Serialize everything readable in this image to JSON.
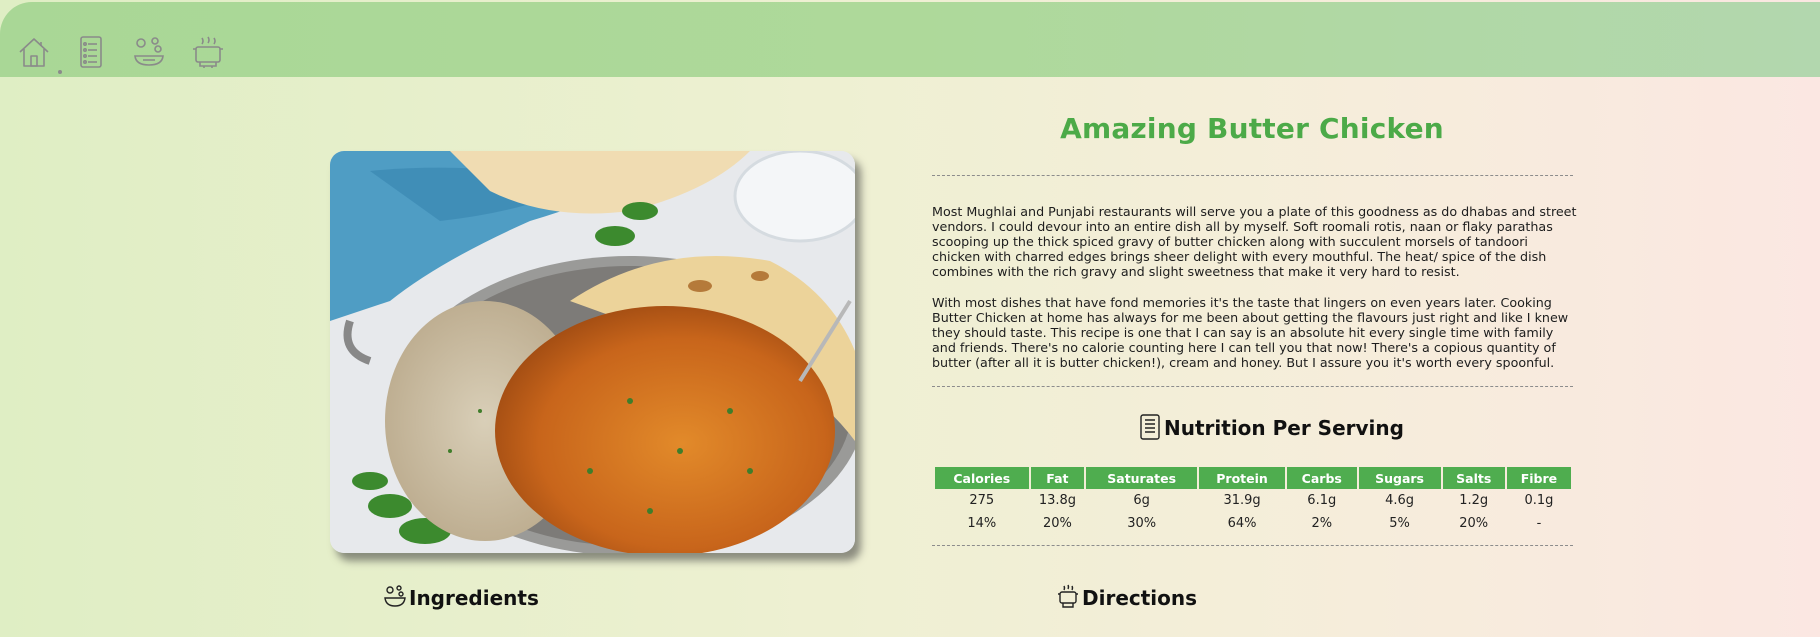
{
  "nav": {
    "items": [
      {
        "icon": "home-icon"
      },
      {
        "icon": "recipe-list-icon"
      },
      {
        "icon": "ingredients-icon"
      },
      {
        "icon": "cooking-pot-icon"
      }
    ]
  },
  "recipe": {
    "title": "Amazing Butter Chicken",
    "image_description": "butter-chicken-photo",
    "description": [
      "Most Mughlai and Punjabi restaurants will serve you a plate of this goodness as do dhabas and street vendors. I could devour into an entire dish all by myself. Soft roomali rotis, naan or flaky parathas scooping up the thick spiced gravy of butter chicken along with succulent morsels of tandoori chicken with charred edges brings sheer delight with every mouthful. The heat/ spice of the dish combines with the rich gravy and slight sweetness that make it very hard to resist.",
      "With most dishes that have fond memories it's the taste that lingers on even years later. Cooking Butter Chicken at home has always for me been about getting the flavours just right and like I knew they should taste. This recipe is one that I can say is an absolute hit every single time with family and friends. There's no calorie counting here I can tell you that now! There's a copious quantity of butter (after all it is butter chicken!), cream and honey. But I assure you it's worth every spoonful."
    ]
  },
  "nutrition": {
    "heading": "Nutrition Per Serving",
    "columns": [
      "Calories",
      "Fat",
      "Saturates",
      "Protein",
      "Carbs",
      "Sugars",
      "Salts",
      "Fibre"
    ],
    "rows": [
      [
        "275",
        "13.8g",
        "6g",
        "31.9g",
        "6.1g",
        "4.6g",
        "1.2g",
        "0.1g"
      ],
      [
        "14%",
        "20%",
        "30%",
        "64%",
        "2%",
        "5%",
        "20%",
        "-"
      ]
    ]
  },
  "sections": {
    "ingredients": "Ingredients",
    "directions": "Directions"
  },
  "colors": {
    "accent_green": "#4caa48",
    "table_header": "#4fad4f",
    "topbar": "#aed99a"
  }
}
